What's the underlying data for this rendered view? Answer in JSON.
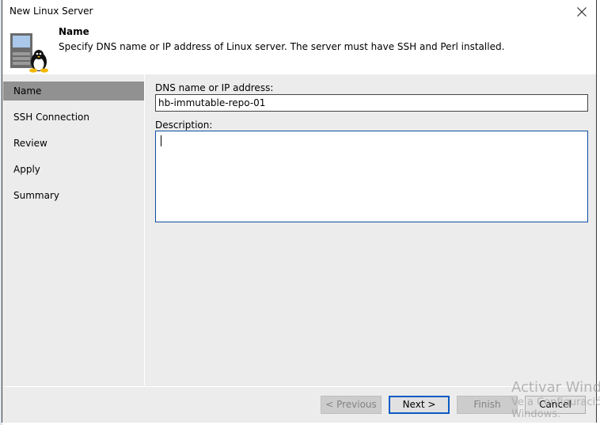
{
  "window": {
    "title": "New Linux Server",
    "close_icon": "close-icon"
  },
  "header": {
    "icon": "linux-server-icon",
    "title": "Name",
    "subtitle": "Specify DNS name or IP address of Linux server. The server must have SSH and Perl installed."
  },
  "sidebar": {
    "items": [
      {
        "label": "Name",
        "active": true
      },
      {
        "label": "SSH Connection",
        "active": false
      },
      {
        "label": "Review",
        "active": false
      },
      {
        "label": "Apply",
        "active": false
      },
      {
        "label": "Summary",
        "active": false
      }
    ]
  },
  "form": {
    "dns_label": "DNS name or IP address:",
    "dns_value": "hb-immutable-repo-01",
    "description_label": "Description:",
    "description_value": ""
  },
  "footer": {
    "previous_label": "< Previous",
    "next_label": "Next >",
    "finish_label": "Finish",
    "cancel_label": "Cancel"
  },
  "watermark": {
    "line1": "Activar Windows",
    "line2": "Ve a Configuración para activar",
    "line3": "Windows."
  },
  "colors": {
    "active_nav": "#919191",
    "focus_border": "#0a4ea3",
    "primary_button_border": "#0a5bc4"
  }
}
